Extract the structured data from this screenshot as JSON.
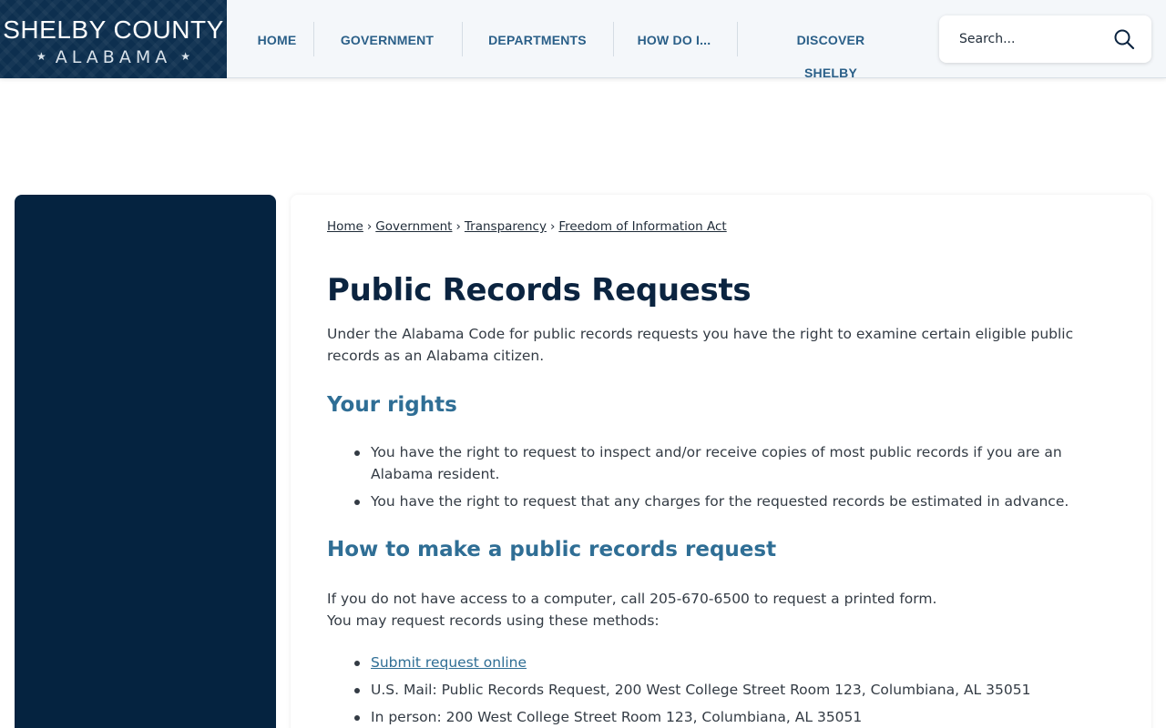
{
  "site": {
    "logo_title": "SHELBY COUNTY",
    "logo_subtitle": "ALABAMA",
    "star": "★"
  },
  "nav": {
    "home": "HOME",
    "government": "GOVERNMENT",
    "departments": "DEPARTMENTS",
    "how_do_i": "HOW DO I...",
    "discover": "DISCOVER SHELBY"
  },
  "search": {
    "placeholder": "Search...",
    "icon": "search-icon"
  },
  "breadcrumb": {
    "items": [
      "Home",
      "Government",
      "Transparency",
      "Freedom of Information Act"
    ],
    "separator": "›"
  },
  "page": {
    "title": "Public Records Requests",
    "intro": "Under the Alabama Code for public records requests you have the right to examine certain eligible public records as an Alabama citizen.",
    "rights_heading": "Your rights",
    "rights": [
      "You have the right to request to inspect and/or receive copies of most public records if you are an Alabama resident.",
      "You have the right to request that any charges for the requested records be estimated in advance."
    ],
    "how_heading": "How to make a public records request",
    "how_line1": "If you do not have access to a computer, call 205-670-6500 to request a printed form.",
    "how_line2": "You may request records using these methods:",
    "methods": {
      "online_link": "Submit request online",
      "mail": "U.S. Mail: Public Records Request, 200 West College Street Room 123, Columbiana, AL 35051",
      "in_person": "In person: 200 West College Street Room 123, Columbiana, AL 35051"
    }
  },
  "colors": {
    "brand_navy": "#0d2f4f",
    "sidebar": "#052340",
    "heading_blue": "#2f6e95",
    "nav_text": "#2a5f88"
  }
}
